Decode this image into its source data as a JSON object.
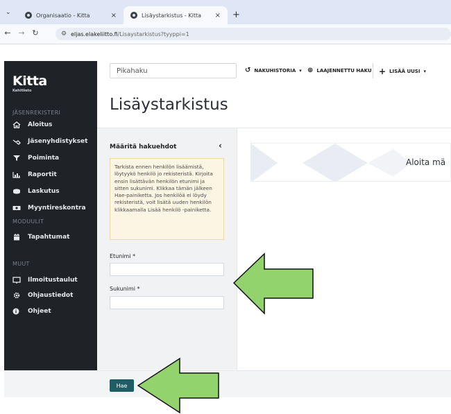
{
  "browser": {
    "tabs": [
      {
        "title": "Organisaatio - Kitta",
        "active": false
      },
      {
        "title": "Lisäystarkistus - Kitta",
        "active": true
      }
    ],
    "new_tab": "+",
    "url_host": "eljas.elakeliitto.fi",
    "url_path": "/Lisaystarkistus?tyyppi=1"
  },
  "sidebar": {
    "logo": "Kitta",
    "logo_sub": "Kehitlieto",
    "sections": [
      {
        "title": "JÄSENREKISTERI",
        "items": [
          {
            "label": "Aloitus",
            "icon": "home-icon"
          },
          {
            "label": "Jäsenyhdistykset",
            "icon": "handshake-icon"
          },
          {
            "label": "Poiminta",
            "icon": "filter-icon"
          },
          {
            "label": "Raportit",
            "icon": "chart-icon"
          },
          {
            "label": "Laskutus",
            "icon": "coins-icon"
          },
          {
            "label": "Myyntireskontra",
            "icon": "money-icon"
          }
        ]
      },
      {
        "title": "MODUULIT",
        "items": [
          {
            "label": "Tapahtumat",
            "icon": "calendar-icon"
          }
        ]
      },
      {
        "title": "MUUT",
        "items": [
          {
            "label": "Ilmoitustaulut",
            "icon": "board-icon"
          },
          {
            "label": "Ohjaustiedot",
            "icon": "cog-icon"
          },
          {
            "label": "Ohjeet",
            "icon": "info-icon"
          }
        ]
      }
    ]
  },
  "topbar": {
    "search_placeholder": "Pikahaku",
    "history": "NAKUHISTORIA",
    "advanced": "LAAJENNETTU HAKU",
    "add_new": "LISÄÄ UUSI"
  },
  "page": {
    "title": "Lisäystarkistus",
    "panel_title": "Määritä hakuehdot",
    "info": "Tarkista ennen henkilön lisäämistä, löytyykö henkilö jo rekisteristä. Kirjoita ensin lisättävän henkilön etunimi ja sitten sukunimi. Klikkaa tämän jälkeen Hae-painiketta. Jos henkilöä ei löydy rekisteristä, voit lisätä uuden henkilön klikkaamalla Lisää henkilö -painiketta.",
    "first_name_label": "Etunimi *",
    "last_name_label": "Sukunimi *",
    "first_name_value": "",
    "last_name_value": "",
    "banner_text": "Aloita mä",
    "search_button": "Hae"
  },
  "colors": {
    "accent": "#1e5c66",
    "sidebar": "#1f2328",
    "arrow_fill": "#92d36e",
    "arrow_stroke": "#111111"
  }
}
